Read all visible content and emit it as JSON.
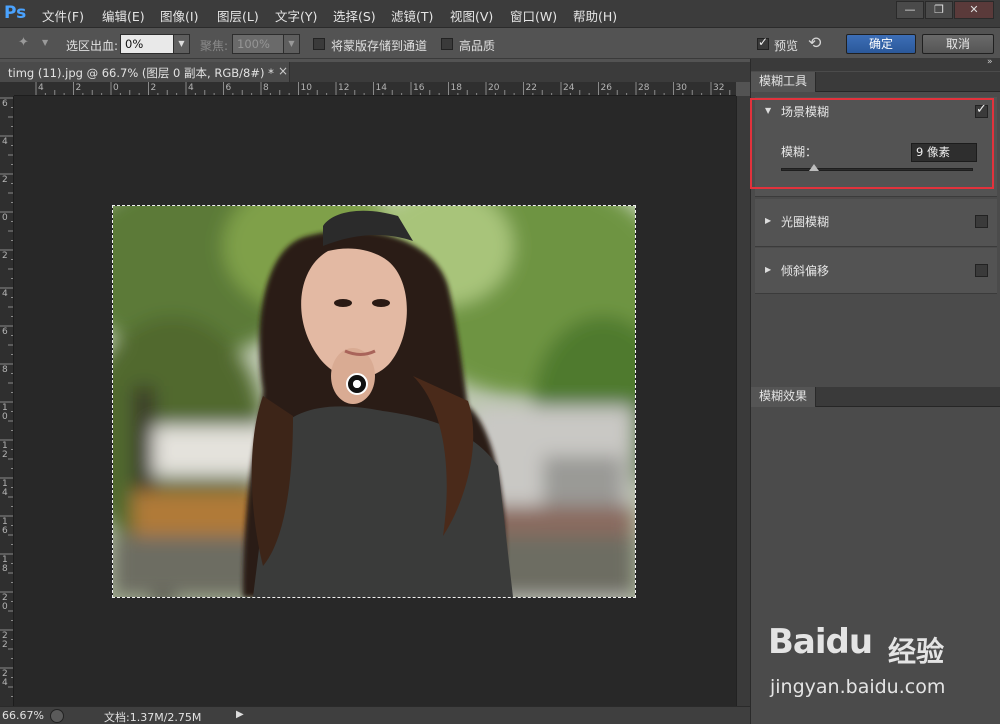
{
  "app": {
    "logo": "Ps"
  },
  "menu": [
    "文件(F)",
    "编辑(E)",
    "图像(I)",
    "图层(L)",
    "文字(Y)",
    "选择(S)",
    "滤镜(T)",
    "视图(V)",
    "窗口(W)",
    "帮助(H)"
  ],
  "window_buttons": [
    "—",
    "❐",
    "✕"
  ],
  "options_bar": {
    "feather_label": "选区出血:",
    "feather_value": "0%",
    "focus_label": "聚焦:",
    "focus_value": "100%",
    "save_mask_label": "将蒙版存储到通道",
    "high_quality_label": "高品质",
    "preview_label": "预览",
    "ok_label": "确定",
    "cancel_label": "取消"
  },
  "document": {
    "tab_title": "timg (11).jpg @ 66.7% (图层 0 副本, RGB/8#) *",
    "close": "×"
  },
  "ruler": {
    "top": [
      "4",
      "2",
      "0",
      "2",
      "4",
      "6",
      "8",
      "10",
      "12",
      "14",
      "16",
      "18",
      "20",
      "22",
      "24",
      "26",
      "28",
      "30",
      "32"
    ],
    "left": [
      "6",
      "4",
      "2",
      "0",
      "2",
      "4",
      "6",
      "8",
      "10",
      "12",
      "14",
      "16",
      "18",
      "20",
      "22",
      "24"
    ]
  },
  "right_panel": {
    "blur_tools_title": "模糊工具",
    "field_blur": {
      "label": "场景模糊",
      "checked": true,
      "blur_label": "模糊：",
      "blur_value": "9 像素",
      "slider_fraction": 0.17
    },
    "iris_blur": {
      "label": "光圈模糊",
      "checked": false
    },
    "tilt_shift": {
      "label": "倾斜偏移",
      "checked": false
    },
    "blur_effects_title": "模糊效果"
  },
  "status": {
    "zoom": "66.67%",
    "doc_info": "文档:1.37M/2.75M"
  },
  "watermark": {
    "logo": "Baidu",
    "cn": "经验",
    "url": "jingyan.baidu.com"
  },
  "colors": {
    "accent": "#4aa3ff",
    "highlight_box": "#e2323c",
    "primary_button": "#2b589a"
  }
}
